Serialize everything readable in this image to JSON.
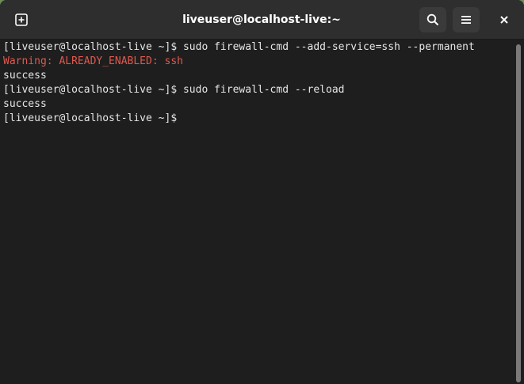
{
  "window": {
    "title": "liveuser@localhost-live:~"
  },
  "header": {
    "new_tab_icon": "new-tab-plus-icon",
    "search_icon": "search-icon",
    "menu_icon": "hamburger-menu-icon",
    "close_icon": "close-icon"
  },
  "terminal": {
    "lines": [
      {
        "text": "[liveuser@localhost-live ~]$ sudo firewall-cmd --add-service=ssh --permanent",
        "kind": "normal"
      },
      {
        "text": "Warning: ALREADY_ENABLED: ssh",
        "kind": "warning"
      },
      {
        "text": "success",
        "kind": "normal"
      },
      {
        "text": "[liveuser@localhost-live ~]$ sudo firewall-cmd --reload",
        "kind": "normal"
      },
      {
        "text": "success",
        "kind": "normal"
      },
      {
        "text": "[liveuser@localhost-live ~]$",
        "kind": "prompt"
      }
    ]
  },
  "colors": {
    "background": "#1e1e1e",
    "headerbar": "#2e2e2e",
    "text": "#e6e6e6",
    "warning": "#e0584f"
  }
}
